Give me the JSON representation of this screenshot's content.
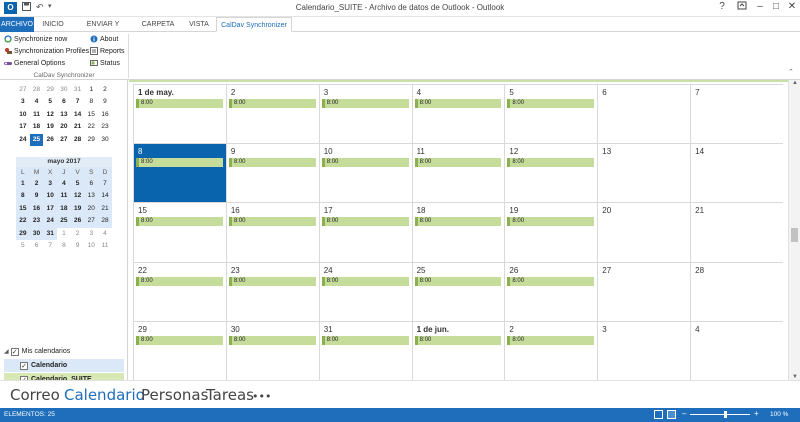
{
  "titlebar": {
    "app_icon": "O",
    "title": "Calendario_SUITE - Archivo de datos de Outlook - Outlook",
    "save_icon": "save-icon",
    "undo_icon": "undo-icon",
    "help": "?",
    "restore_icon": "ribbon-restore-icon",
    "minimize": "–",
    "maximize": "□",
    "close": "✕"
  },
  "tabs": [
    "ARCHIVO",
    "INICIO",
    "ENVIAR Y RECIBIR",
    "CARPETA",
    "VISTA",
    "CalDav Synchronizer"
  ],
  "ribbon": {
    "buttons": [
      {
        "label": "Synchronize now",
        "icon": "sync-icon"
      },
      {
        "label": "Synchronization Profiles",
        "icon": "profiles-icon"
      },
      {
        "label": "General Options",
        "icon": "options-icon"
      },
      {
        "label": "About",
        "icon": "about-icon"
      },
      {
        "label": "Reports",
        "icon": "reports-icon"
      },
      {
        "label": "Status",
        "icon": "status-icon"
      }
    ],
    "group_label": "CalDav Synchronizer"
  },
  "mini_april": {
    "rows": [
      [
        "27",
        "28",
        "29",
        "30",
        "31",
        "1",
        "2"
      ],
      [
        "3",
        "4",
        "5",
        "6",
        "7",
        "8",
        "9"
      ],
      [
        "10",
        "11",
        "12",
        "13",
        "14",
        "15",
        "16"
      ],
      [
        "17",
        "18",
        "19",
        "20",
        "21",
        "22",
        "23"
      ],
      [
        "24",
        "25",
        "26",
        "27",
        "28",
        "29",
        "30"
      ]
    ]
  },
  "mini_may": {
    "header": "mayo 2017",
    "dow": [
      "L",
      "M",
      "X",
      "J",
      "V",
      "S",
      "D"
    ],
    "rows": [
      [
        "1",
        "2",
        "3",
        "4",
        "5",
        "6",
        "7"
      ],
      [
        "8",
        "9",
        "10",
        "11",
        "12",
        "13",
        "14"
      ],
      [
        "15",
        "16",
        "17",
        "18",
        "19",
        "20",
        "21"
      ],
      [
        "22",
        "23",
        "24",
        "25",
        "26",
        "27",
        "28"
      ],
      [
        "29",
        "30",
        "31",
        "1",
        "2",
        "3",
        "4"
      ],
      [
        "5",
        "6",
        "7",
        "8",
        "9",
        "10",
        "11"
      ]
    ]
  },
  "calendars": {
    "group": "Mis calendarios",
    "items": [
      "Calendario",
      "Calendario_SUITE"
    ],
    "check": "✓"
  },
  "month": {
    "weeks": [
      [
        {
          "d": "1 de may.",
          "b": true,
          "appt": "8:00"
        },
        {
          "d": "2",
          "appt": "8:00"
        },
        {
          "d": "3",
          "appt": "8:00"
        },
        {
          "d": "4",
          "appt": "8:00"
        },
        {
          "d": "5",
          "appt": "8:00"
        },
        {
          "d": "6"
        },
        {
          "d": "7"
        }
      ],
      [
        {
          "d": "8",
          "appt": "8:00",
          "sel": true
        },
        {
          "d": "9",
          "appt": "8:00"
        },
        {
          "d": "10",
          "appt": "8:00"
        },
        {
          "d": "11",
          "appt": "8:00"
        },
        {
          "d": "12",
          "appt": "8:00"
        },
        {
          "d": "13"
        },
        {
          "d": "14"
        }
      ],
      [
        {
          "d": "15",
          "appt": "8:00"
        },
        {
          "d": "16",
          "appt": "8:00"
        },
        {
          "d": "17",
          "appt": "8:00"
        },
        {
          "d": "18",
          "appt": "8:00"
        },
        {
          "d": "19",
          "appt": "8:00"
        },
        {
          "d": "20"
        },
        {
          "d": "21"
        }
      ],
      [
        {
          "d": "22",
          "appt": "8:00"
        },
        {
          "d": "23",
          "appt": "8:00"
        },
        {
          "d": "24",
          "appt": "8:00"
        },
        {
          "d": "25",
          "appt": "8:00"
        },
        {
          "d": "26",
          "appt": "8:00"
        },
        {
          "d": "27"
        },
        {
          "d": "28"
        }
      ],
      [
        {
          "d": "29",
          "appt": "8:00"
        },
        {
          "d": "30",
          "appt": "8:00"
        },
        {
          "d": "31",
          "appt": "8:00"
        },
        {
          "d": "1 de jun.",
          "b": true,
          "appt": "8:00"
        },
        {
          "d": "2",
          "appt": "8:00"
        },
        {
          "d": "3"
        },
        {
          "d": "4"
        }
      ]
    ]
  },
  "nav": {
    "items": [
      "Correo",
      "Calendario",
      "Personas",
      "Tareas",
      "•••"
    ],
    "active": "Calendario"
  },
  "status": {
    "left": "ELEMENTOS: 25",
    "zoom": "100 %",
    "minus": "–",
    "plus": "+"
  },
  "colors": {
    "accent": "#1e6ebc",
    "appointment": "#c6dc9b",
    "selected_day": "#0a64ad"
  }
}
